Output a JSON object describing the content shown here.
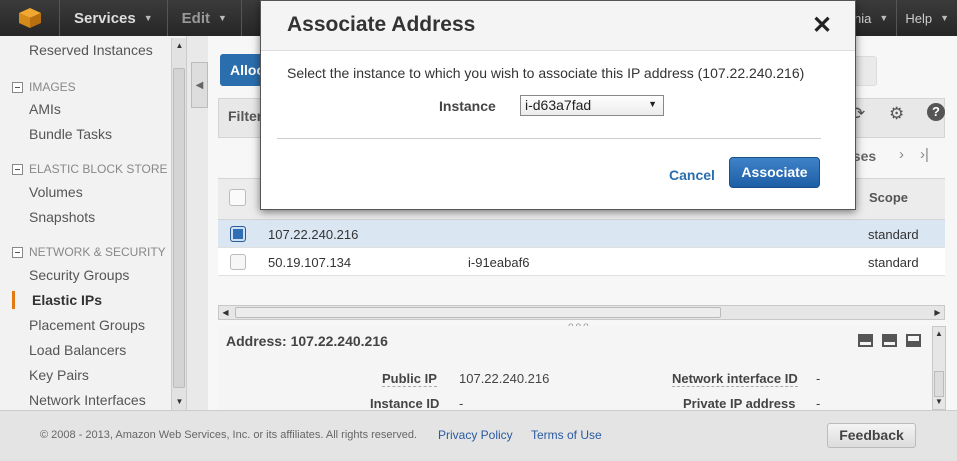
{
  "topnav": {
    "services": "Services",
    "edit": "Edit",
    "region": "inia",
    "help": "Help"
  },
  "sidebar": {
    "cut_item": "Reserved Instances",
    "sections": [
      {
        "title": "IMAGES",
        "items": [
          "AMIs",
          "Bundle Tasks"
        ]
      },
      {
        "title": "ELASTIC BLOCK STORE",
        "items": [
          "Volumes",
          "Snapshots"
        ]
      },
      {
        "title": "NETWORK & SECURITY",
        "items": [
          "Security Groups",
          "Elastic IPs",
          "Placement Groups",
          "Load Balancers",
          "Key Pairs",
          "Network Interfaces"
        ]
      }
    ],
    "active": "Elastic IPs"
  },
  "toolbar": {
    "allocate_label": "Alloc",
    "filter_label": "Filter"
  },
  "pager": {
    "label": "sses"
  },
  "table": {
    "scope_header": "Scope",
    "rows": [
      {
        "ip": "107.22.240.216",
        "instance": "",
        "scope": "standard",
        "selected": true
      },
      {
        "ip": "50.19.107.134",
        "instance": "i-91eabaf6",
        "scope": "standard",
        "selected": false
      }
    ]
  },
  "detail": {
    "title": "Address: 107.22.240.216",
    "public_ip_label": "Public IP",
    "public_ip_value": "107.22.240.216",
    "instance_id_label": "Instance ID",
    "instance_id_value": "-",
    "network_interface_label": "Network interface ID",
    "network_interface_value": "-",
    "private_ip_label": "Private IP address",
    "private_ip_value": "-"
  },
  "footer": {
    "copyright": "© 2008 - 2013, Amazon Web Services, Inc. or its affiliates. All rights reserved.",
    "privacy": "Privacy Policy",
    "terms": "Terms of Use",
    "feedback": "Feedback"
  },
  "modal": {
    "title": "Associate Address",
    "close": "✕",
    "message": "Select the instance to which you wish to associate this IP address (107.22.240.216)",
    "instance_label": "Instance",
    "instance_value": "i-d63a7fad",
    "cancel": "Cancel",
    "associate": "Associate"
  }
}
